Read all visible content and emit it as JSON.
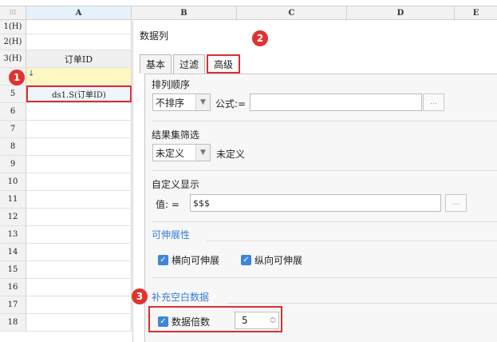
{
  "sheet": {
    "corner_icon": "grid-icon",
    "columns": [
      "A",
      "B",
      "C",
      "D",
      "E"
    ],
    "rows": [
      {
        "num": "1(H)",
        "a": ""
      },
      {
        "num": "2(H)",
        "a": ""
      },
      {
        "num": "3(H)",
        "a": "订单ID"
      },
      {
        "num": "4",
        "a": ""
      },
      {
        "num": "5",
        "a": "ds1.S(订单ID)"
      },
      {
        "num": "6",
        "a": ""
      },
      {
        "num": "7",
        "a": ""
      },
      {
        "num": "8",
        "a": ""
      },
      {
        "num": "9",
        "a": ""
      },
      {
        "num": "10",
        "a": ""
      },
      {
        "num": "11",
        "a": ""
      },
      {
        "num": "12",
        "a": ""
      },
      {
        "num": "13",
        "a": ""
      },
      {
        "num": "14",
        "a": ""
      },
      {
        "num": "15",
        "a": ""
      },
      {
        "num": "16",
        "a": ""
      },
      {
        "num": "17",
        "a": ""
      },
      {
        "num": "18",
        "a": ""
      }
    ]
  },
  "dialog": {
    "title": "数据列",
    "tabs": [
      {
        "label": "基本"
      },
      {
        "label": "过滤"
      },
      {
        "label": "高级",
        "active": true
      }
    ],
    "sort": {
      "label": "排列顺序",
      "selected": "不排序",
      "formula_label": "公式:=",
      "formula_value": "",
      "dots": "..."
    },
    "filter": {
      "label": "结果集筛选",
      "selected": "未定义",
      "text": "未定义"
    },
    "custom_display": {
      "label": "自定义显示",
      "value_label": "值:  =",
      "value": "$$$",
      "dots": "..."
    },
    "expand": {
      "label": "可伸展性",
      "horizontal": "横向可伸展",
      "vertical": "纵向可伸展"
    },
    "fill_blank": {
      "label": "补充空白数据",
      "multiple_label": "数据倍数",
      "multiple_value": "5"
    }
  },
  "badges": [
    "1",
    "2",
    "3"
  ],
  "colors": {
    "badge_red": "#e0322f",
    "checkbox_blue": "#3e87d8",
    "section_blue": "#3a7bd5",
    "highlight_yellow": "#fdf7c3"
  }
}
